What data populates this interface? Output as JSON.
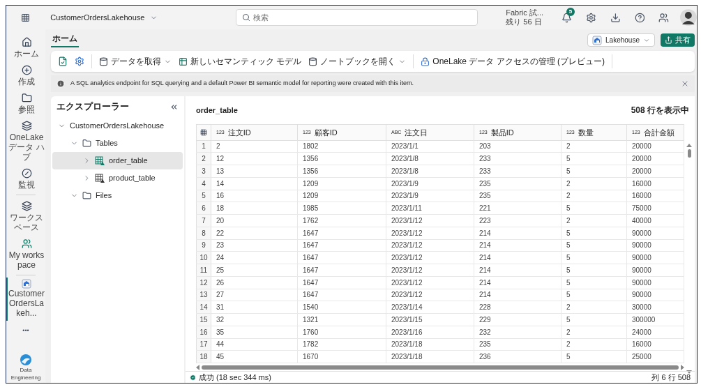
{
  "top_bar": {
    "workspace_item": "CustomerOrdersLakehouse",
    "search": {
      "placeholder": "検索"
    },
    "trial": {
      "line_1": "Fabric 試...",
      "line_2": "残り 56 日"
    },
    "notification_count": "5"
  },
  "rail": {
    "items": [
      {
        "label": "ホーム",
        "selected": false
      },
      {
        "label": "作成",
        "selected": false
      },
      {
        "label": "参照",
        "selected": false
      },
      {
        "label": "OneLake データ ハブ",
        "selected": false
      },
      {
        "label": "監視",
        "selected": false
      },
      {
        "label": "ワークスペース",
        "selected": false
      },
      {
        "label": "My workspace",
        "selected": false
      },
      {
        "label": "CustomerOrdersLakeh...",
        "selected": true
      }
    ],
    "more": "•••",
    "footer": "Data Engineering"
  },
  "tabs": [
    {
      "label": "ホーム",
      "selected": true
    }
  ],
  "item_type": "Lakehouse",
  "share": "共有",
  "toolbar": [
    {
      "label": "データを取得",
      "dropdown": true
    },
    {
      "label": "新しいセマンティック モデル",
      "dropdown": false
    },
    {
      "label": "ノートブックを開く",
      "dropdown": true
    },
    {
      "label": "OneLake データ アクセスの管理 (プレビュー)",
      "dropdown": false
    }
  ],
  "info_bar": "A SQL analytics endpoint for SQL querying and a default Power BI semantic model for reporting were created with this item.",
  "explorer": {
    "title": "エクスプローラー",
    "tree": [
      {
        "label": "CustomerOrdersLakehouse",
        "expanded": true,
        "selected": false,
        "children": [
          {
            "label": "Tables",
            "kind": "folder",
            "expanded": true,
            "selected": false,
            "children": [
              {
                "label": "order_table",
                "kind": "table",
                "expanded": false,
                "selected": true
              },
              {
                "label": "product_table",
                "kind": "table",
                "expanded": false,
                "selected": false
              }
            ]
          },
          {
            "label": "Files",
            "kind": "folder",
            "expanded": true,
            "selected": false
          }
        ]
      }
    ]
  },
  "table": {
    "name": "order_table",
    "row_count": "508 行を表示中",
    "columns": [
      {
        "type": "123",
        "label": "注文ID"
      },
      {
        "type": "123",
        "label": "顧客ID"
      },
      {
        "type": "ABC",
        "label": "注文日"
      },
      {
        "type": "123",
        "label": "製品ID"
      },
      {
        "type": "123",
        "label": "数量"
      },
      {
        "type": "123",
        "label": "合計金額"
      }
    ],
    "rows": [
      {
        "n": "1",
        "cells": [
          "2",
          "1802",
          "2023/1/1",
          "203",
          "2",
          "20000"
        ]
      },
      {
        "n": "2",
        "cells": [
          "12",
          "1356",
          "2023/1/8",
          "233",
          "5",
          "20000"
        ]
      },
      {
        "n": "3",
        "cells": [
          "13",
          "1356",
          "2023/1/8",
          "233",
          "5",
          "20000"
        ]
      },
      {
        "n": "4",
        "cells": [
          "14",
          "1209",
          "2023/1/9",
          "235",
          "2",
          "16000"
        ]
      },
      {
        "n": "5",
        "cells": [
          "16",
          "1209",
          "2023/1/9",
          "235",
          "2",
          "16000"
        ]
      },
      {
        "n": "6",
        "cells": [
          "18",
          "1985",
          "2023/1/11",
          "221",
          "5",
          "75000"
        ]
      },
      {
        "n": "7",
        "cells": [
          "20",
          "1762",
          "2023/1/12",
          "223",
          "2",
          "40000"
        ]
      },
      {
        "n": "8",
        "cells": [
          "22",
          "1647",
          "2023/1/12",
          "214",
          "5",
          "90000"
        ]
      },
      {
        "n": "9",
        "cells": [
          "23",
          "1647",
          "2023/1/12",
          "214",
          "5",
          "90000"
        ]
      },
      {
        "n": "10",
        "cells": [
          "24",
          "1647",
          "2023/1/12",
          "214",
          "5",
          "90000"
        ]
      },
      {
        "n": "11",
        "cells": [
          "25",
          "1647",
          "2023/1/12",
          "214",
          "5",
          "90000"
        ]
      },
      {
        "n": "12",
        "cells": [
          "26",
          "1647",
          "2023/1/12",
          "214",
          "5",
          "90000"
        ]
      },
      {
        "n": "13",
        "cells": [
          "27",
          "1647",
          "2023/1/12",
          "214",
          "5",
          "90000"
        ]
      },
      {
        "n": "14",
        "cells": [
          "31",
          "1540",
          "2023/1/14",
          "228",
          "2",
          "30000"
        ]
      },
      {
        "n": "15",
        "cells": [
          "32",
          "1321",
          "2023/1/15",
          "229",
          "5",
          "300000"
        ]
      },
      {
        "n": "16",
        "cells": [
          "35",
          "1760",
          "2023/1/16",
          "232",
          "2",
          "24000"
        ]
      },
      {
        "n": "17",
        "cells": [
          "44",
          "1782",
          "2023/1/18",
          "235",
          "2",
          "16000"
        ]
      },
      {
        "n": "18",
        "cells": [
          "45",
          "1670",
          "2023/1/18",
          "236",
          "5",
          "25000"
        ]
      }
    ]
  },
  "status_bar": {
    "message": "成功 (18 sec 344 ms)",
    "position": "列 6 行 508"
  }
}
